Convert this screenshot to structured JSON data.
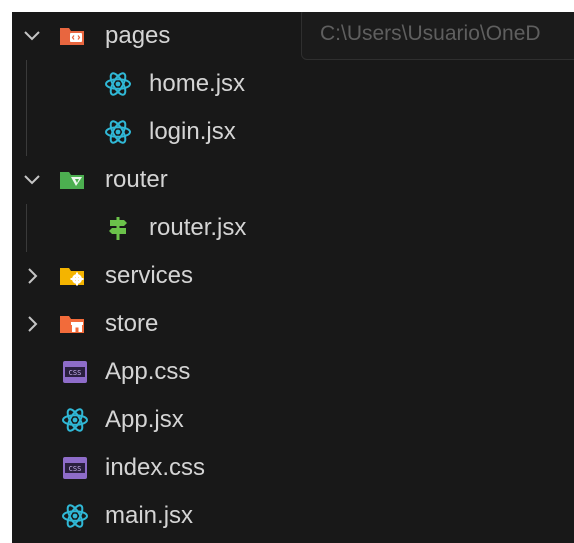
{
  "tooltip": {
    "text": "C:\\Users\\Usuario\\OneD"
  },
  "tree": {
    "pages": {
      "label": "pages",
      "expanded": true
    },
    "home": {
      "label": "home.jsx"
    },
    "login": {
      "label": "login.jsx"
    },
    "router": {
      "label": "router",
      "expanded": true
    },
    "router_file": {
      "label": "router.jsx"
    },
    "services": {
      "label": "services",
      "expanded": false
    },
    "store": {
      "label": "store",
      "expanded": false
    },
    "app_css": {
      "label": "App.css"
    },
    "app_jsx": {
      "label": "App.jsx"
    },
    "index_css": {
      "label": "index.css"
    },
    "main_jsx": {
      "label": "main.jsx"
    }
  },
  "colors": {
    "background": "#181818",
    "text": "#d4d4d4",
    "react": "#30b8d6",
    "css": "#8e6cc9",
    "pages_folder": "#e8663f",
    "router_folder": "#4caf50",
    "services_folder": "#f4b400",
    "store_folder": "#f26b3a"
  },
  "icons": {
    "chevron_open": "chevron-down-icon",
    "chevron_closed": "chevron-right-icon",
    "react_file": "react-icon",
    "css_file": "css-icon",
    "router_file": "signpost-icon"
  }
}
